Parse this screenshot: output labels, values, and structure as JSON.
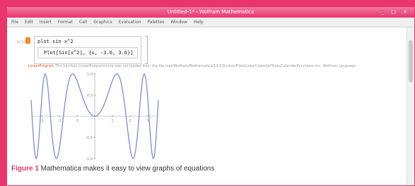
{
  "window": {
    "title": "Untitled-1* - Wolfram Mathematica",
    "controls": "_ □ ×"
  },
  "menubar": {
    "items": [
      "File",
      "Edit",
      "Insert",
      "Format",
      "Cell",
      "Graphics",
      "Evaluation",
      "Palettes",
      "Window",
      "Help"
    ]
  },
  "notebook": {
    "cell_label": "In[1]:=",
    "input_line": "plot sin x^2",
    "plot_command": "Plot[Sin[x^2], {x, -3.6, 3.6}]",
    "message_key": "LinearProgram",
    "message_text": "The function LinearProgramming was not loaded from the file /opt/Wolfram/Mathematica/10.0/SystemFiles/Links/CalendarTools/CalendarFunctions.mx, Wolfram Language"
  },
  "chart_data": {
    "type": "line",
    "x_range": [
      -3.6,
      3.6
    ],
    "y_range": [
      -1,
      1
    ],
    "x_ticks": [
      "-3",
      "-2",
      "-1",
      "1",
      "2",
      "3"
    ],
    "y_ticks": [
      "1.0",
      "0.5",
      "-0.5",
      "-1.0"
    ],
    "series": [
      {
        "color": "#7b8fc9"
      }
    ]
  },
  "caption": {
    "figure_label": "Figure 1",
    "text": " Mathematica makes it easy to view graphs of equations"
  }
}
